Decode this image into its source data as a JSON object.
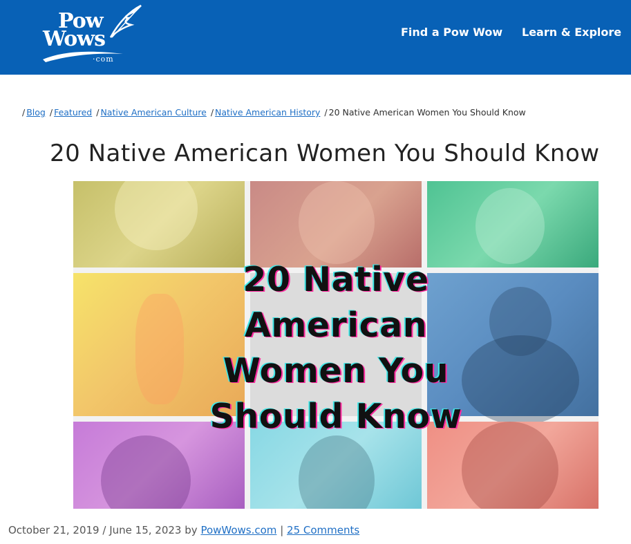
{
  "header": {
    "logo": {
      "line1": "Pow",
      "line2": "Wows",
      "line3": "·com"
    },
    "nav": [
      {
        "label": "Find a Pow Wow"
      },
      {
        "label": "Learn & Explore"
      }
    ],
    "background_color": "#0861b6"
  },
  "breadcrumb": {
    "separator": "/",
    "items": [
      {
        "label": "Blog"
      },
      {
        "label": "Featured"
      },
      {
        "label": "Native American Culture"
      },
      {
        "label": "Native American History"
      }
    ],
    "current": "20 Native American Women You Should Know"
  },
  "article": {
    "title": "20 Native American Women You Should Know",
    "hero": {
      "lines": [
        "20 Native",
        "American",
        "Women You",
        "Should Know"
      ],
      "tile_colors": [
        "#c6c06a",
        "#c98a86",
        "#4fc393",
        "#f6e36a",
        "#dcdcdc",
        "#6ea1cf",
        "#c67bd8",
        "#88d8e4",
        "#ef8f84"
      ]
    },
    "meta": {
      "published": "October 21, 2019",
      "date_separator": "/",
      "updated": "June 15, 2023",
      "by": "by",
      "author": "PowWows.com",
      "pipe": "|",
      "comments": "25 Comments"
    }
  },
  "colors": {
    "link": "#1f6fc5",
    "title_text": "#222222"
  }
}
